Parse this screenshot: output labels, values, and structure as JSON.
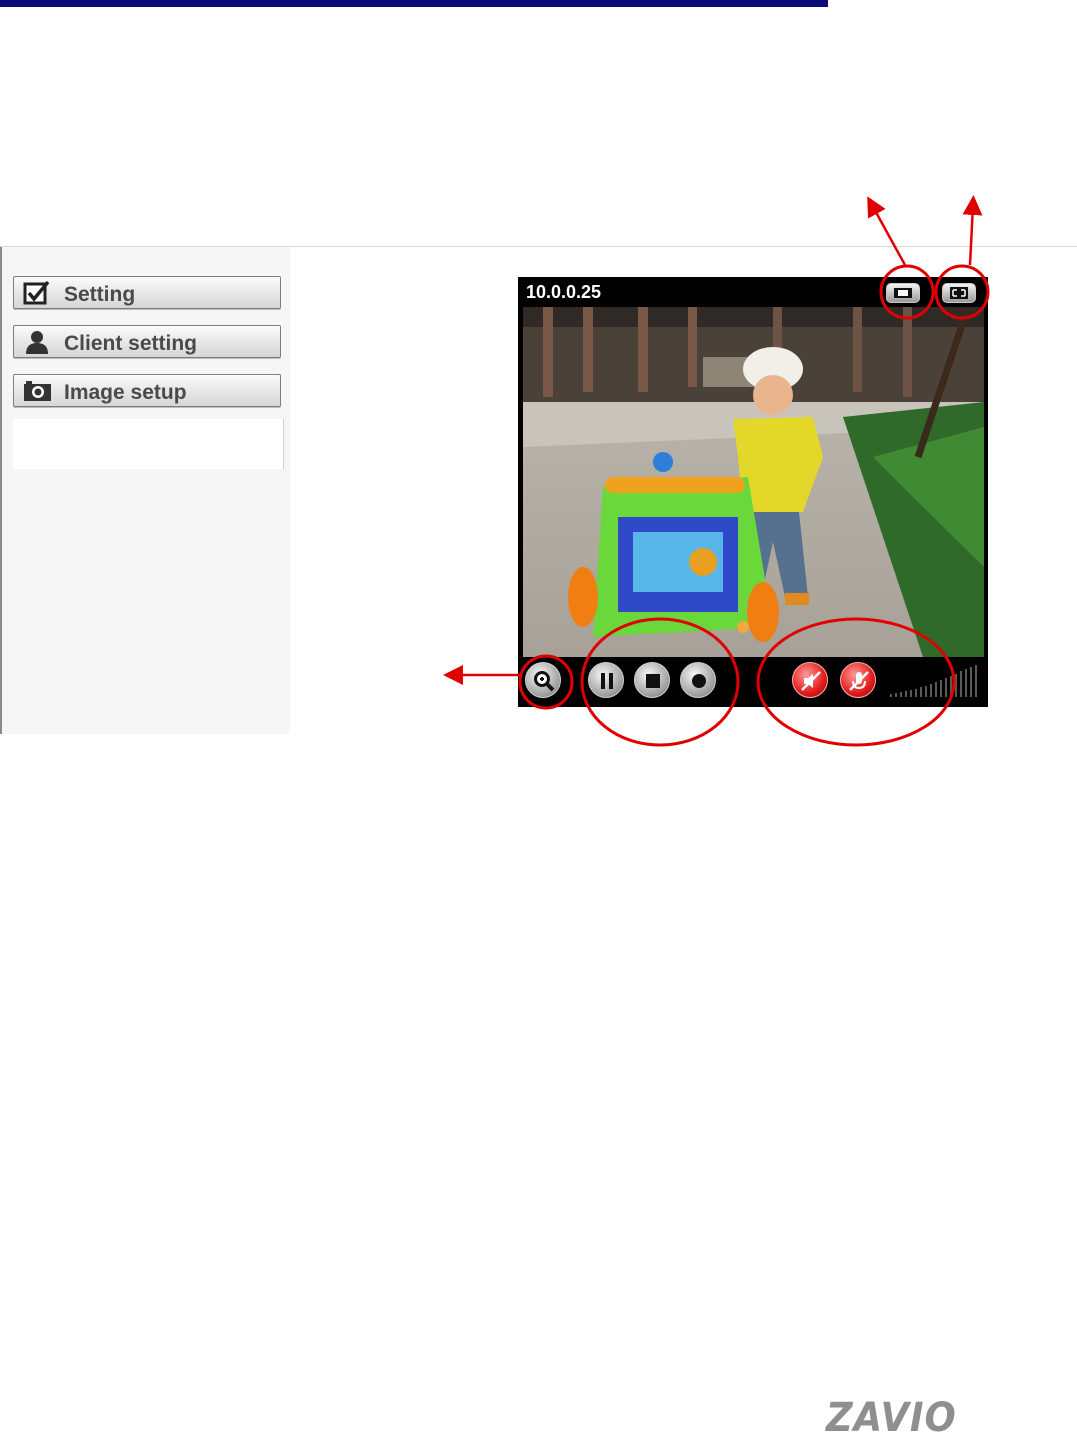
{
  "sidebar": {
    "items": [
      {
        "label": "Setting",
        "icon": "checkbox-icon"
      },
      {
        "label": "Client setting",
        "icon": "user-icon"
      },
      {
        "label": "Image setup",
        "icon": "camera-icon"
      }
    ]
  },
  "viewer": {
    "ip_address": "10.0.0.25",
    "top_buttons": [
      "window-size-icon",
      "fullscreen-icon"
    ],
    "controls": [
      "zoom-icon",
      "pause-icon",
      "stop-icon",
      "record-icon",
      "speaker-mute-icon",
      "microphone-mute-icon"
    ]
  },
  "footer": {
    "logo_text": "ZAVIO"
  },
  "colors": {
    "top_rule": "#0b0b7a",
    "annotation": "#e00000",
    "viewer_bg": "#000000"
  }
}
